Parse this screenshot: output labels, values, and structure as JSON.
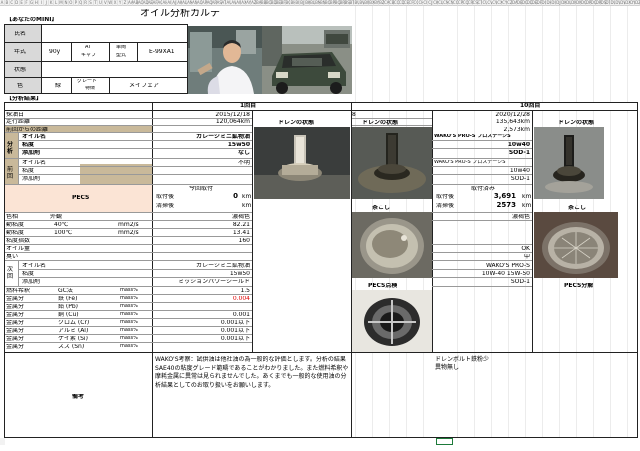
{
  "title": "オイル分析カルテ",
  "section_mini": "【あなたのMINI】",
  "section_results": "【分析結果】",
  "mini_info": {
    "name_label": "氏名",
    "year_label": "年式",
    "year_value": "90y",
    "trans_label": "AT",
    "trans_sub": "キャブ",
    "model_label": "車両",
    "model_sub": "型式",
    "model_value": "E-99XA1",
    "status_label": "状態",
    "color_label": "色",
    "color_value": "緑",
    "grade_label": "グレード",
    "grade_sub": "特徴",
    "grade_value": "メイフェア"
  },
  "round1": {
    "title": "1回目",
    "date": "2015/12/18",
    "mileage": "120,064km",
    "drain_label_a": "ドレンの状態",
    "drain_label_b": "ドレンの状態",
    "strainer_label": "茶こし",
    "pecs_label": "PECS点検",
    "num8": "8"
  },
  "round10": {
    "title": "10回目",
    "date": "2020/12/28",
    "mileage": "135,643km",
    "distance": "2,573km",
    "drain_label_a": "ドレンの状態",
    "drain_label_b": "ドレンの状態",
    "strainer_label": "茶こし",
    "pecs_label": "PECS分解"
  },
  "rows": {
    "sample_date": "採油日",
    "mileage": "走行距離",
    "prev_distance": "前回からの距離",
    "an_group": "分析",
    "oil_name": "オイル名",
    "viscosity": "粘度",
    "additive": "添加剤",
    "prev_group": "前回",
    "prev_oil_name": "オイル名",
    "prev_viscosity": "粘度",
    "prev_additive": "添加剤",
    "pecs": "PECS",
    "color": "色相",
    "appearance": "外観",
    "kin_visc": "動粘度",
    "kin_visc2": "動粘度",
    "t40": "40℃",
    "t100": "100℃",
    "unit_mm2s": "mm2/s",
    "unit_mm2s_b": "mm2/s",
    "visc_index": "粘度指数",
    "oil_amount": "オイル量",
    "odor": "臭い",
    "next_group": "次回",
    "next_oil_name": "オイル名",
    "next_viscosity": "粘度",
    "next_additive": "添加剤",
    "fuel_dilution": "燃料希釈",
    "gc": "GC法",
    "unit_mass": "mass%",
    "metal": "金属分",
    "fe": "鉄 (Fe)",
    "pb": "鉛 (Pb)",
    "cu": "銅 (Cu)",
    "cr": "クロム (Cr)",
    "al": "アルミ (Al)",
    "si": "ケイ素 (Si)",
    "sn": "スズ (Sn)",
    "remarks": "備考"
  },
  "values1": {
    "oil_name": "ガレージミニ鉱物油",
    "viscosity": "15w50",
    "additive": "なし",
    "prev_oil_name": "不明",
    "pecs_title": "今回取付",
    "pecs_fitted": "取付後",
    "pecs_fitted_val": "0",
    "pecs_removed": "清掃後",
    "pecs_removed_val": "",
    "km": "km",
    "color": "濃褐色",
    "v40": "82.21",
    "v100": "13.41",
    "vi": "160",
    "next_oil_name": "ガレージミニ鉱物油",
    "next_viscosity": "15w50",
    "next_additive": "ミッションパワーシールド",
    "fuel": "1.5",
    "fe": "0.004",
    "cu": "0.001",
    "cr": "0.001以下",
    "al": "0.001以下",
    "si": "0.001以下",
    "remarks": "WAKO'S考察：試供油は他社油の為一般的な評価とします。分析の結果SAE40の粘度グレード範疇であることがわかりました。また燃料希釈や摩耗金属に異常は見られませんでした。あくまでも一般的な使用油の分析結果としてのお取り扱いをお願いします。"
  },
  "values10": {
    "oil_name": "WAKO'S PRO-S プロステージS",
    "viscosity": "10w40",
    "additive": "SOD-1",
    "prev_oil_name": "WAKO'S PRO-S プロステージS",
    "prev_viscosity": "10w40",
    "prev_additive": "SOD-1",
    "pecs_title": "取付済み",
    "pecs_fitted": "取付後",
    "pecs_fitted_val": "3,691",
    "pecs_removed": "清掃後",
    "pecs_removed_val": "2573",
    "km": "km",
    "color": "濃褐色",
    "oil_amount": "OK",
    "odor": "中",
    "next_oil_name": "WAKO'S PRO-S",
    "next_viscosity": "10W-40 15W-50",
    "next_additive": "SOD-1",
    "remarks": "ドレンボルト鉄粉少\n異物無し"
  },
  "col_letters": [
    "A",
    "B",
    "C",
    "D",
    "E",
    "F",
    "G",
    "H",
    "I",
    "J",
    "K",
    "L",
    "M",
    "N",
    "O",
    "P",
    "Q",
    "R",
    "S",
    "T",
    "U",
    "V",
    "W",
    "X",
    "Y",
    "Z",
    "AA",
    "AB",
    "AC",
    "AD",
    "AE",
    "AF",
    "AG",
    "AH",
    "AI",
    "AJ",
    "AK",
    "AL",
    "AM",
    "AN",
    "AO",
    "AP",
    "AQ",
    "AR",
    "AS",
    "AT",
    "AU",
    "AV",
    "AW",
    "AX",
    "AY",
    "AZ",
    "BA",
    "BB",
    "BC",
    "BD",
    "BE",
    "BF",
    "BG",
    "BH",
    "BI",
    "BJ",
    "BK",
    "BL",
    "BM",
    "BN",
    "BO",
    "BP",
    "BQ",
    "BR",
    "BS",
    "BT",
    "BU",
    "BV",
    "BW",
    "BX",
    "BY",
    "BZ",
    "CA",
    "CB",
    "CC",
    "CD",
    "CE",
    "CF",
    "CG",
    "CH",
    "CI",
    "CJ",
    "CK",
    "CL",
    "CM",
    "CN",
    "CO",
    "CP",
    "CQ",
    "CR",
    "CS",
    "CT",
    "CU",
    "CV",
    "CW",
    "CX",
    "CY",
    "CZ",
    "DA",
    "DB",
    "DC",
    "DD",
    "DE",
    "DF",
    "DG",
    "DH",
    "DI",
    "DJ",
    "DK",
    "DL",
    "DM",
    "DN",
    "DO",
    "DP",
    "DQ",
    "DR",
    "DS",
    "DT",
    "DU",
    "DV",
    "DW",
    "DX",
    "DY",
    "DZ"
  ],
  "colors": {
    "tan": "#c9b99a",
    "peach": "#fbe4d5",
    "header_gray": "#d9d9d9",
    "red_value": "#e00000",
    "selected_border": "#1d7a3a"
  }
}
